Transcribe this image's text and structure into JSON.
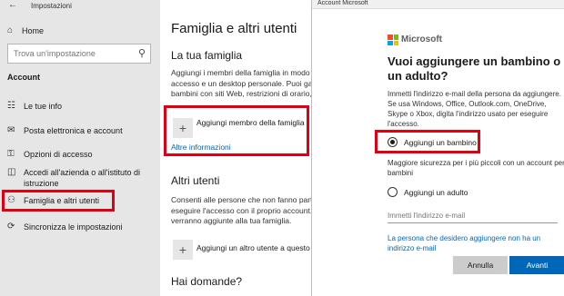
{
  "settings": {
    "window_title": "Impostazioni",
    "sidebar": {
      "home_label": "Home",
      "search_placeholder": "Trova un'impostazione",
      "section_label": "Account",
      "items": [
        {
          "label": "Le tue info",
          "icon": "person-card-icon"
        },
        {
          "label": "Posta elettronica e account",
          "icon": "mail-icon"
        },
        {
          "label": "Opzioni di accesso",
          "icon": "key-icon"
        },
        {
          "label": "Accedi all'azienda o all'istituto di istruzione",
          "icon": "briefcase-icon"
        },
        {
          "label": "Famiglia e altri utenti",
          "icon": "people-icon",
          "selected": true
        },
        {
          "label": "Sincronizza le impostazioni",
          "icon": "sync-icon"
        }
      ]
    },
    "main": {
      "title": "Famiglia e altri utenti",
      "family": {
        "heading": "La tua famiglia",
        "description": "Aggiungi i membri della famiglia in modo\naccesso e un desktop personale. Puoi gar\nbambini con siti Web, restrizioni di orario,",
        "add_label": "Aggiungi membro della famiglia",
        "more_info": "Altre informazioni"
      },
      "others": {
        "heading": "Altri utenti",
        "description": "Consenti alle persone che non fanno part\neseguire l'accesso con il proprio account.\nverranno aggiunte alla tua famiglia.",
        "add_label": "Aggiungi un altro utente a questo"
      },
      "questions_heading": "Hai domande?"
    }
  },
  "dialog": {
    "window_title": "Account Microsoft",
    "brand": "Microsoft",
    "heading": "Vuoi aggiungere un bambino o un adulto?",
    "description": "Immetti l'indirizzo e-mail della persona da aggiungere. Se usa Windows, Office, Outlook.com, OneDrive, Skype o Xbox, digita l'indirizzo usato per eseguire l'accesso.",
    "option_child": "Aggiungi un bambino",
    "child_note": "Maggiore sicurezza per i più piccoli con un account per bambini",
    "option_adult": "Aggiungi un adulto",
    "email_placeholder": "Immetti l'indirizzo e-mail",
    "no_email_link": "La persona che desidero aggiungere non ha un indirizzo e-mail",
    "cancel_label": "Annulla",
    "next_label": "Avanti",
    "selected_option": "child"
  },
  "colors": {
    "highlight": "#e1000f",
    "link": "#0067c0",
    "primary_button": "#0067b8",
    "sidebar_bg": "#e6e6e6",
    "ms_red": "#f25022",
    "ms_green": "#7fba00",
    "ms_blue": "#00a4ef",
    "ms_yellow": "#ffb900"
  }
}
